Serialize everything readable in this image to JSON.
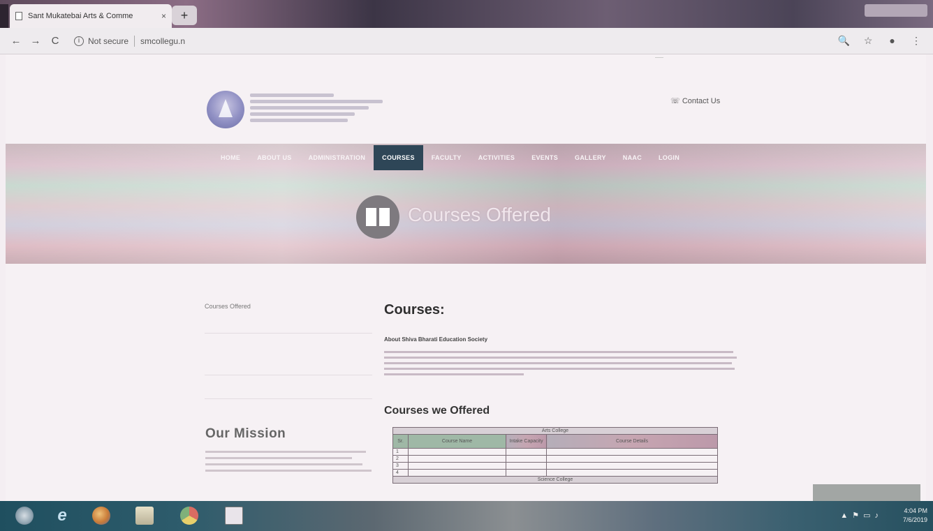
{
  "browser": {
    "tab_title": "Sant Mukatebai Arts & Comme",
    "tab_close": "×",
    "new_tab": "+",
    "window_controls": "",
    "security_label": "Not secure",
    "url": "smcollegu.n",
    "url_faded": "",
    "nav": {
      "back": "←",
      "forward": "→",
      "reload": "C"
    },
    "right_icons": {
      "search": "🔍",
      "bookmark": "☆",
      "account": "●",
      "menu": "⋮"
    }
  },
  "site": {
    "topbar": {
      "phone": "",
      "email": "",
      "language": ""
    },
    "contact_label": "Contact Us",
    "nav_items": [
      "HOME",
      "ABOUT US",
      "ADMINISTRATION",
      "COURSES",
      "FACULTY",
      "ACTIVITIES",
      "EVENTS",
      "GALLERY",
      "NAAC",
      "LOGIN"
    ],
    "nav_active": "COURSES",
    "hero_title": "Courses Offered",
    "sidebar": {
      "title": "Courses Offered",
      "mission_heading": "Our Mission"
    },
    "main": {
      "heading": "Courses:",
      "about_heading": "About Shiva Bharati Education Society",
      "offered_heading": "Courses we Offered"
    },
    "table": {
      "group1": "Arts College",
      "group2": "Science College",
      "headers": [
        "Sr.",
        "Course Name",
        "Intake Capacity",
        "Course Details"
      ],
      "rows": [
        {
          "sr": "1",
          "course": "",
          "intake": "",
          "details": ""
        },
        {
          "sr": "2",
          "course": "",
          "intake": "",
          "details": ""
        },
        {
          "sr": "3",
          "course": "",
          "intake": "",
          "details": ""
        },
        {
          "sr": "4",
          "course": "",
          "intake": "",
          "details": ""
        }
      ]
    },
    "floating_box": ""
  },
  "taskbar": {
    "time": "4:04 PM",
    "date": "7/6/2019"
  }
}
